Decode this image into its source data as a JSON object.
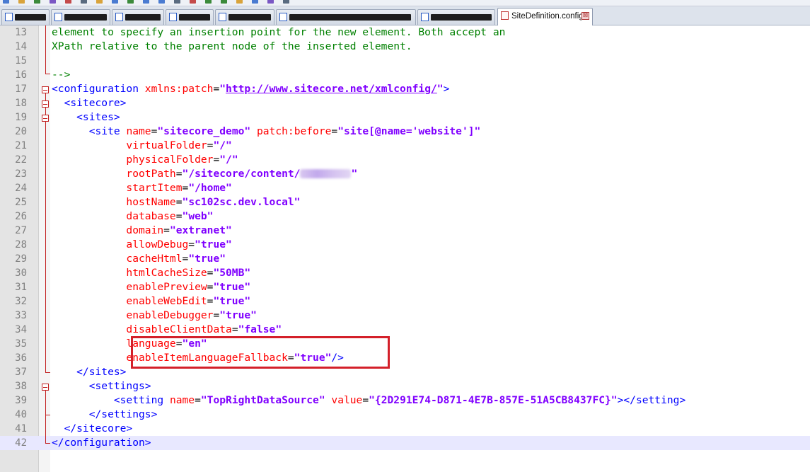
{
  "toolbar": {
    "icons": [
      "new-file-icon",
      "open-file-icon",
      "save-icon",
      "save-all-icon",
      "close-icon",
      "print-icon",
      "cut-icon",
      "copy-icon",
      "paste-icon",
      "undo-icon",
      "redo-icon",
      "find-icon",
      "replace-icon",
      "zoom-in-icon",
      "zoom-out-icon",
      "sync-icon",
      "wrap-icon",
      "indent-icon",
      "macro-icon"
    ]
  },
  "tabs": {
    "active_label": "SiteDefinition.config",
    "close_glyph": "⊠"
  },
  "editor": {
    "current_line": "42",
    "lines": [
      {
        "n": "13",
        "tokens": [
          {
            "t": "element to specify an insertion point for the new element. Both accept an",
            "c": "com"
          }
        ]
      },
      {
        "n": "14",
        "tokens": [
          {
            "t": "XPath relative to the parent node of the inserted element.",
            "c": "com"
          }
        ]
      },
      {
        "n": "15",
        "tokens": []
      },
      {
        "n": "16",
        "tokens": [
          {
            "t": "-->",
            "c": "com"
          }
        ]
      },
      {
        "n": "17",
        "tokens": [
          {
            "t": "<configuration ",
            "c": "tag"
          },
          {
            "t": "xmlns:patch",
            "c": "attr"
          },
          {
            "t": "=",
            "c": "eq"
          },
          {
            "t": "\"",
            "c": "val"
          },
          {
            "t": "http://www.sitecore.net/xmlconfig/",
            "c": "url"
          },
          {
            "t": "\"",
            "c": "val"
          },
          {
            "t": ">",
            "c": "tag"
          }
        ]
      },
      {
        "n": "18",
        "tokens": [
          {
            "t": "  <sitecore>",
            "c": "tag"
          }
        ]
      },
      {
        "n": "19",
        "tokens": [
          {
            "t": "    <sites>",
            "c": "tag"
          }
        ]
      },
      {
        "n": "20",
        "tokens": [
          {
            "t": "      <site ",
            "c": "tag"
          },
          {
            "t": "name",
            "c": "attr"
          },
          {
            "t": "=",
            "c": "eq"
          },
          {
            "t": "\"sitecore_demo\"",
            "c": "val"
          },
          {
            "t": " patch:before",
            "c": "attr"
          },
          {
            "t": "=",
            "c": "eq"
          },
          {
            "t": "\"site[@name='website']\"",
            "c": "val"
          }
        ]
      },
      {
        "n": "21",
        "tokens": [
          {
            "t": "            virtualFolder",
            "c": "attr"
          },
          {
            "t": "=",
            "c": "eq"
          },
          {
            "t": "\"/\"",
            "c": "val"
          }
        ]
      },
      {
        "n": "22",
        "tokens": [
          {
            "t": "            physicalFolder",
            "c": "attr"
          },
          {
            "t": "=",
            "c": "eq"
          },
          {
            "t": "\"/\"",
            "c": "val"
          }
        ]
      },
      {
        "n": "23",
        "tokens": [
          {
            "t": "            rootPath",
            "c": "attr"
          },
          {
            "t": "=",
            "c": "eq"
          },
          {
            "t": "\"/sitecore/content/",
            "c": "val"
          },
          {
            "t": "",
            "c": "blur"
          },
          {
            "t": "\"",
            "c": "val"
          }
        ]
      },
      {
        "n": "24",
        "tokens": [
          {
            "t": "            startItem",
            "c": "attr"
          },
          {
            "t": "=",
            "c": "eq"
          },
          {
            "t": "\"/home\"",
            "c": "val"
          }
        ]
      },
      {
        "n": "25",
        "tokens": [
          {
            "t": "            hostName",
            "c": "attr"
          },
          {
            "t": "=",
            "c": "eq"
          },
          {
            "t": "\"sc102sc.dev.local\"",
            "c": "val"
          }
        ]
      },
      {
        "n": "26",
        "tokens": [
          {
            "t": "            database",
            "c": "attr"
          },
          {
            "t": "=",
            "c": "eq"
          },
          {
            "t": "\"web\"",
            "c": "val"
          }
        ]
      },
      {
        "n": "27",
        "tokens": [
          {
            "t": "            domain",
            "c": "attr"
          },
          {
            "t": "=",
            "c": "eq"
          },
          {
            "t": "\"extranet\"",
            "c": "val"
          }
        ]
      },
      {
        "n": "28",
        "tokens": [
          {
            "t": "            allowDebug",
            "c": "attr"
          },
          {
            "t": "=",
            "c": "eq"
          },
          {
            "t": "\"true\"",
            "c": "val"
          }
        ]
      },
      {
        "n": "29",
        "tokens": [
          {
            "t": "            cacheHtml",
            "c": "attr"
          },
          {
            "t": "=",
            "c": "eq"
          },
          {
            "t": "\"true\"",
            "c": "val"
          }
        ]
      },
      {
        "n": "30",
        "tokens": [
          {
            "t": "            htmlCacheSize",
            "c": "attr"
          },
          {
            "t": "=",
            "c": "eq"
          },
          {
            "t": "\"50MB\"",
            "c": "val"
          }
        ]
      },
      {
        "n": "31",
        "tokens": [
          {
            "t": "            enablePreview",
            "c": "attr"
          },
          {
            "t": "=",
            "c": "eq"
          },
          {
            "t": "\"true\"",
            "c": "val"
          }
        ]
      },
      {
        "n": "32",
        "tokens": [
          {
            "t": "            enableWebEdit",
            "c": "attr"
          },
          {
            "t": "=",
            "c": "eq"
          },
          {
            "t": "\"true\"",
            "c": "val"
          }
        ]
      },
      {
        "n": "33",
        "tokens": [
          {
            "t": "            enableDebugger",
            "c": "attr"
          },
          {
            "t": "=",
            "c": "eq"
          },
          {
            "t": "\"true\"",
            "c": "val"
          }
        ]
      },
      {
        "n": "34",
        "tokens": [
          {
            "t": "            disableClientData",
            "c": "attr"
          },
          {
            "t": "=",
            "c": "eq"
          },
          {
            "t": "\"false\"",
            "c": "val"
          }
        ]
      },
      {
        "n": "35",
        "tokens": [
          {
            "t": "            language",
            "c": "attr"
          },
          {
            "t": "=",
            "c": "eq"
          },
          {
            "t": "\"en\"",
            "c": "val"
          }
        ]
      },
      {
        "n": "36",
        "tokens": [
          {
            "t": "            enableItemLanguageFallback",
            "c": "attr"
          },
          {
            "t": "=",
            "c": "eq"
          },
          {
            "t": "\"true\"",
            "c": "val"
          },
          {
            "t": "/>",
            "c": "tag"
          }
        ]
      },
      {
        "n": "37",
        "tokens": [
          {
            "t": "    </sites>",
            "c": "tag"
          }
        ]
      },
      {
        "n": "38",
        "tokens": [
          {
            "t": "      <settings>",
            "c": "tag"
          }
        ]
      },
      {
        "n": "39",
        "tokens": [
          {
            "t": "          <setting ",
            "c": "tag"
          },
          {
            "t": "name",
            "c": "attr"
          },
          {
            "t": "=",
            "c": "eq"
          },
          {
            "t": "\"TopRightDataSource\"",
            "c": "val"
          },
          {
            "t": " value",
            "c": "attr"
          },
          {
            "t": "=",
            "c": "eq"
          },
          {
            "t": "\"{2D291E74-D871-4E7B-857E-51A5CB8437FC}\"",
            "c": "val"
          },
          {
            "t": "></setting>",
            "c": "tag"
          }
        ]
      },
      {
        "n": "40",
        "tokens": [
          {
            "t": "      </settings>",
            "c": "tag"
          }
        ]
      },
      {
        "n": "41",
        "tokens": [
          {
            "t": "  </sitecore>",
            "c": "tag"
          }
        ]
      },
      {
        "n": "42",
        "tokens": [
          {
            "t": "</configuration>",
            "c": "tag"
          }
        ]
      }
    ]
  }
}
